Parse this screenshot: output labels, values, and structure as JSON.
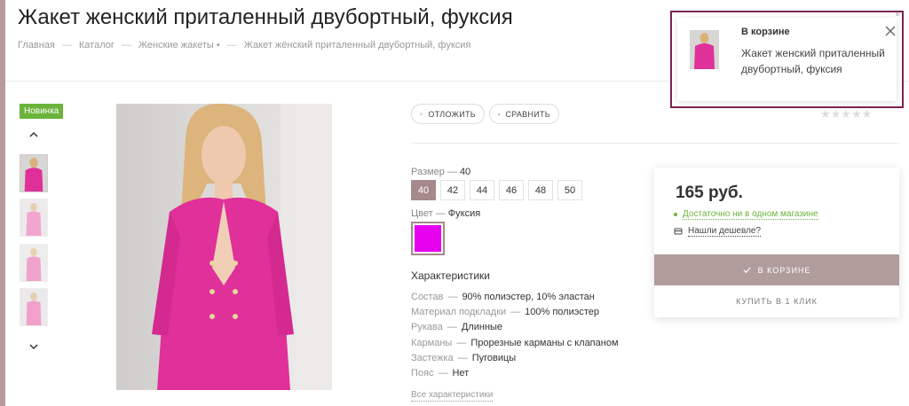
{
  "product": {
    "title": "Жакет женский приталенный двубортный, фуксия"
  },
  "breadcrumb": [
    "Главная",
    "Каталог",
    "Женские жакеты •",
    "Жакет жёнский приталенный двубортный, фуксия"
  ],
  "breadcrumb_separator": "—",
  "gallery": {
    "badge": "Новинка"
  },
  "actions": {
    "defer_label": "ОТЛОЖИТЬ",
    "compare_label": "СРАВНИТЬ"
  },
  "rating": {
    "stars": "★★★★★",
    "value": 0,
    "max": 5
  },
  "size": {
    "label": "Размер",
    "dash": "—",
    "selected": "40",
    "options": [
      "40",
      "42",
      "44",
      "46",
      "48",
      "50"
    ]
  },
  "color": {
    "label": "Цвет",
    "dash": "—",
    "selected": "Фуксия",
    "swatch": "#e600ee"
  },
  "characteristics": {
    "title": "Характеристики",
    "rows": [
      {
        "name": "Состав",
        "value": "90% полиэстер, 10% эластан"
      },
      {
        "name": "Материал подкладки",
        "value": "100% полиэстер"
      },
      {
        "name": "Рукава",
        "value": "Длинные"
      },
      {
        "name": "Карманы",
        "value": "Прорезные карманы с клапаном"
      },
      {
        "name": "Застежка",
        "value": "Пуговицы"
      },
      {
        "name": "Пояс",
        "value": "Нет"
      }
    ],
    "all_link": "Все характеристики"
  },
  "buy": {
    "price": "165 руб.",
    "stock": "Достаточно ни в одном магазине",
    "cheaper": "Нашли дешевле?",
    "in_cart": "В КОРЗИНЕ",
    "one_click": "КУПИТЬ В 1 КЛИК"
  },
  "toast": {
    "title": "В корзине",
    "text": "Жакет женский приталенный двубортный, фуксия"
  },
  "colors": {
    "accent": "#a6898a",
    "cart_button": "#b09c9b",
    "toast_border": "#7b2452",
    "badge": "#6bb33a",
    "jacket": "#e0309a"
  },
  "icons": {
    "heart": "heart-icon",
    "compare": "bar-chart-icon",
    "check": "check-icon",
    "close": "close-icon",
    "tag": "price-tag-icon",
    "chevron_up": "chevron-up-icon",
    "chevron_down": "chevron-down-icon"
  }
}
